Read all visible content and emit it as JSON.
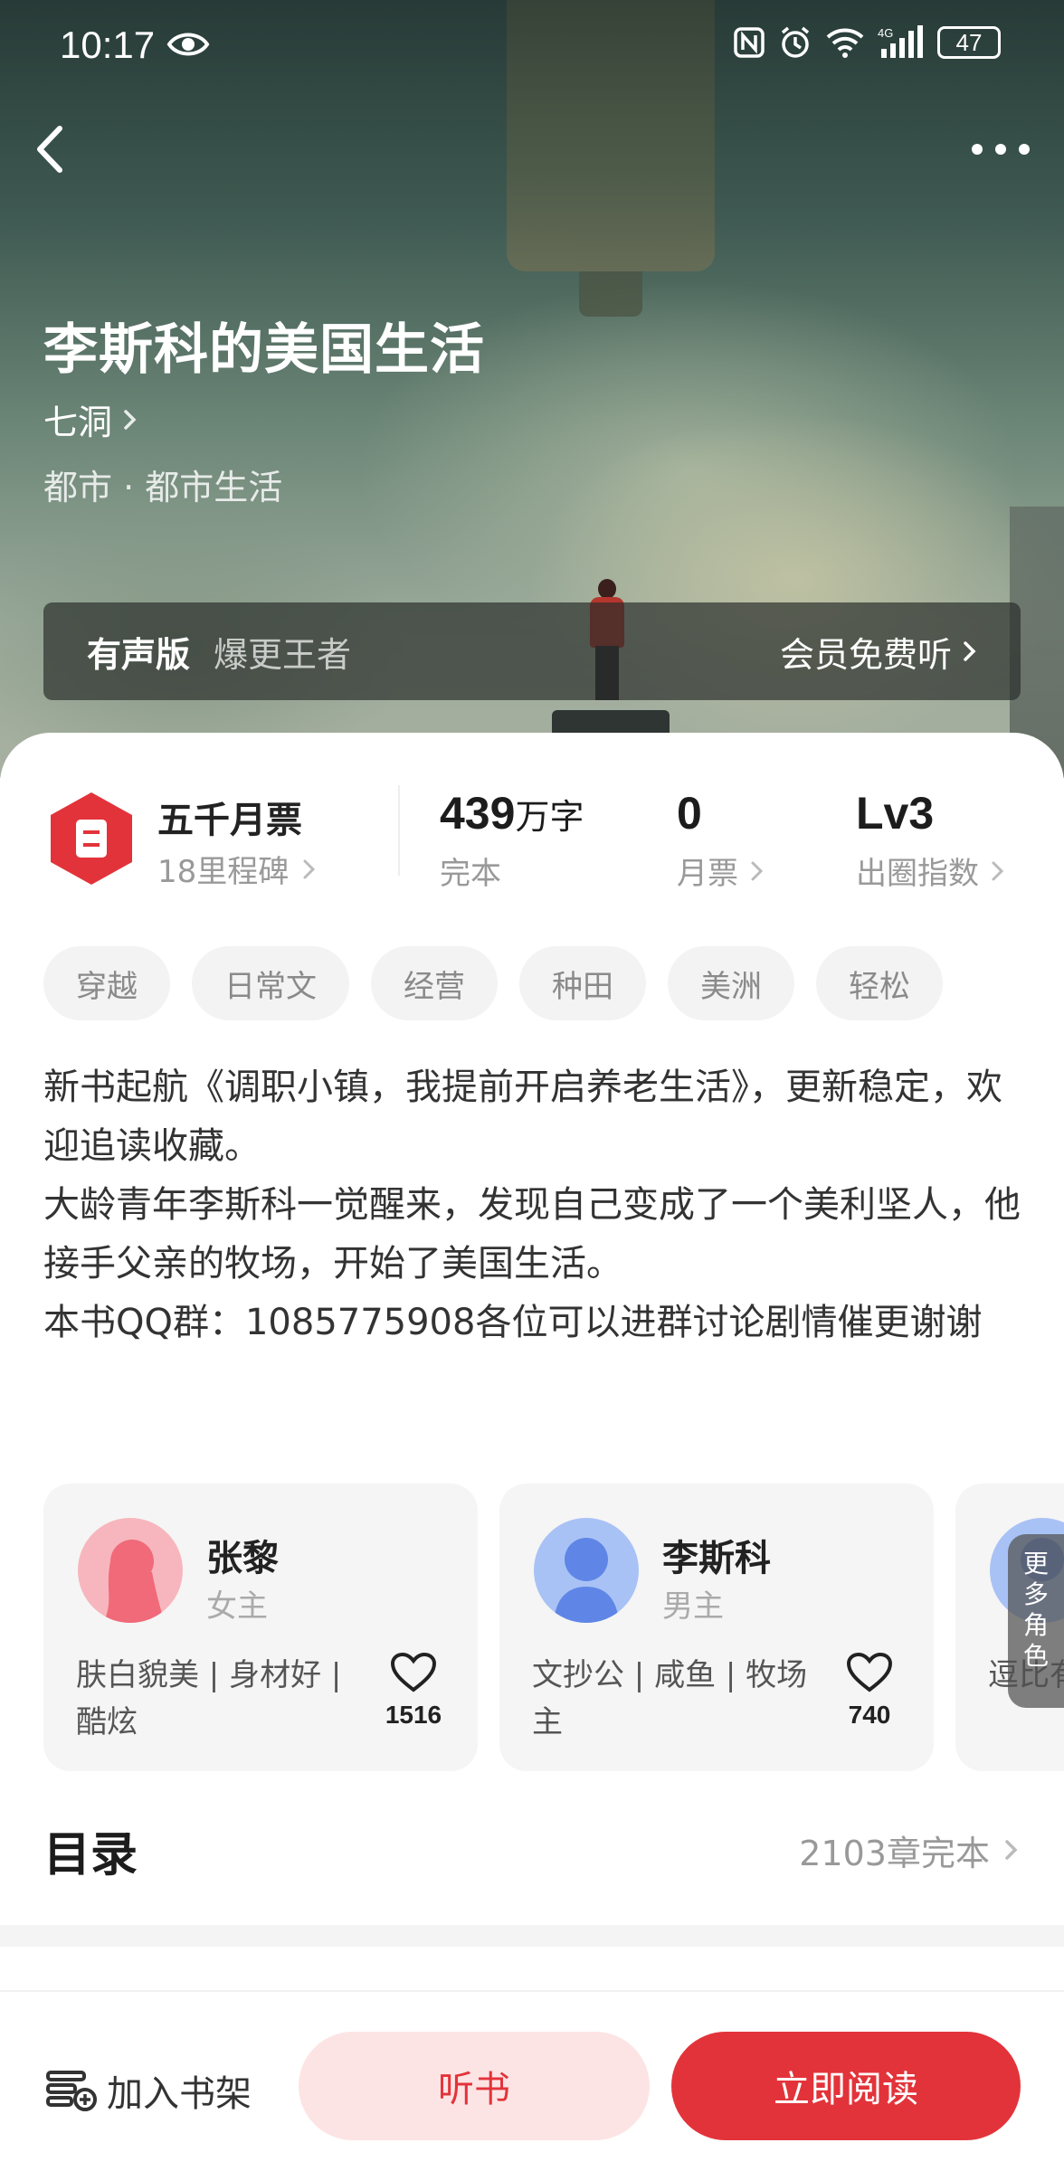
{
  "status_bar": {
    "time": "10:17",
    "battery": "47",
    "network": "4G"
  },
  "colors": {
    "accent": "#e3333a",
    "accent_soft": "#fde4e4",
    "tag_bg": "#f3f3f3"
  },
  "book": {
    "title": "李斯科的美国生活",
    "author": "七洞",
    "genre": "都市 · 都市生活"
  },
  "audio_banner": {
    "label": "有声版",
    "subtitle": "爆更王者",
    "cta": "会员免费听"
  },
  "stats": {
    "ticket_title": "五千月票",
    "ticket_sub": "18里程碑",
    "words_value": "439",
    "words_unit": "万字",
    "words_label": "完本",
    "votes_value": "0",
    "votes_label": "月票",
    "level_value": "Lv3",
    "level_label": "出圈指数"
  },
  "tags": [
    "穿越",
    "日常文",
    "经营",
    "种田",
    "美洲",
    "轻松"
  ],
  "intro": [
    "新书起航《调职小镇，我提前开启养老生活》，更新稳定，欢迎追读收藏。",
    "大龄青年李斯科一觉醒来，发现自己变成了一个美利坚人，他接手父亲的牧场，开始了美国生活。",
    "本书QQ群：1085775908各位可以进群讨论剧情催更谢谢"
  ],
  "characters": [
    {
      "name": "张黎",
      "role": "女主",
      "desc": "肤白貌美 | 身材好 | 酷炫",
      "likes": "1516"
    },
    {
      "name": "李斯科",
      "role": "男主",
      "desc": "文抄公 | 咸鱼 | 牧场主",
      "likes": "740"
    },
    {
      "desc": "逗比有"
    }
  ],
  "more_roles": "更多角色",
  "catalog": {
    "title": "目录",
    "info": "2103章完本"
  },
  "bottom": {
    "shelf": "加入书架",
    "listen": "听书",
    "read": "立即阅读"
  },
  "icons": [
    "eye-icon",
    "nfc-icon",
    "alarm-icon",
    "wifi-icon",
    "signal-icon",
    "back-icon",
    "more-icon",
    "chevron-right-icon",
    "ticket-icon",
    "heart-icon",
    "bookshelf-add-icon"
  ]
}
